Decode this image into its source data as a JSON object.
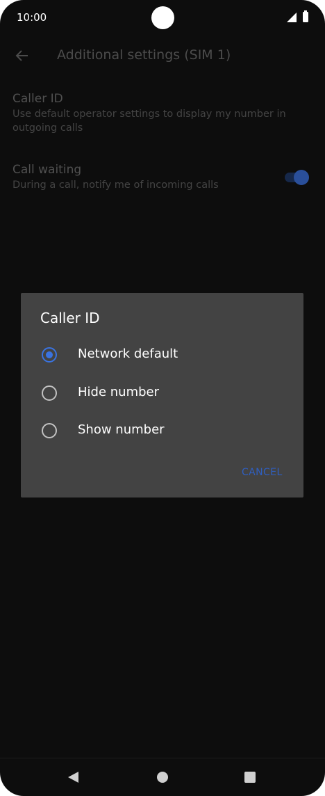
{
  "status_bar": {
    "time": "10:00"
  },
  "app_bar": {
    "title": "Additional settings (SIM 1)",
    "back_icon": "arrow-left-icon"
  },
  "settings": [
    {
      "title": "Caller ID",
      "subtitle": "Use default operator settings to display my number in outgoing calls"
    },
    {
      "title": "Call waiting",
      "subtitle": "During a call, notify me of incoming calls",
      "toggle_on": true
    }
  ],
  "dialog": {
    "title": "Caller ID",
    "options": [
      {
        "label": "Network default",
        "selected": true
      },
      {
        "label": "Hide number",
        "selected": false
      },
      {
        "label": "Show number",
        "selected": false
      }
    ],
    "cancel_label": "CANCEL"
  },
  "colors": {
    "accent": "#3a73e0",
    "dialog_bg": "#434343",
    "screen_bg": "#0d0d0d"
  }
}
